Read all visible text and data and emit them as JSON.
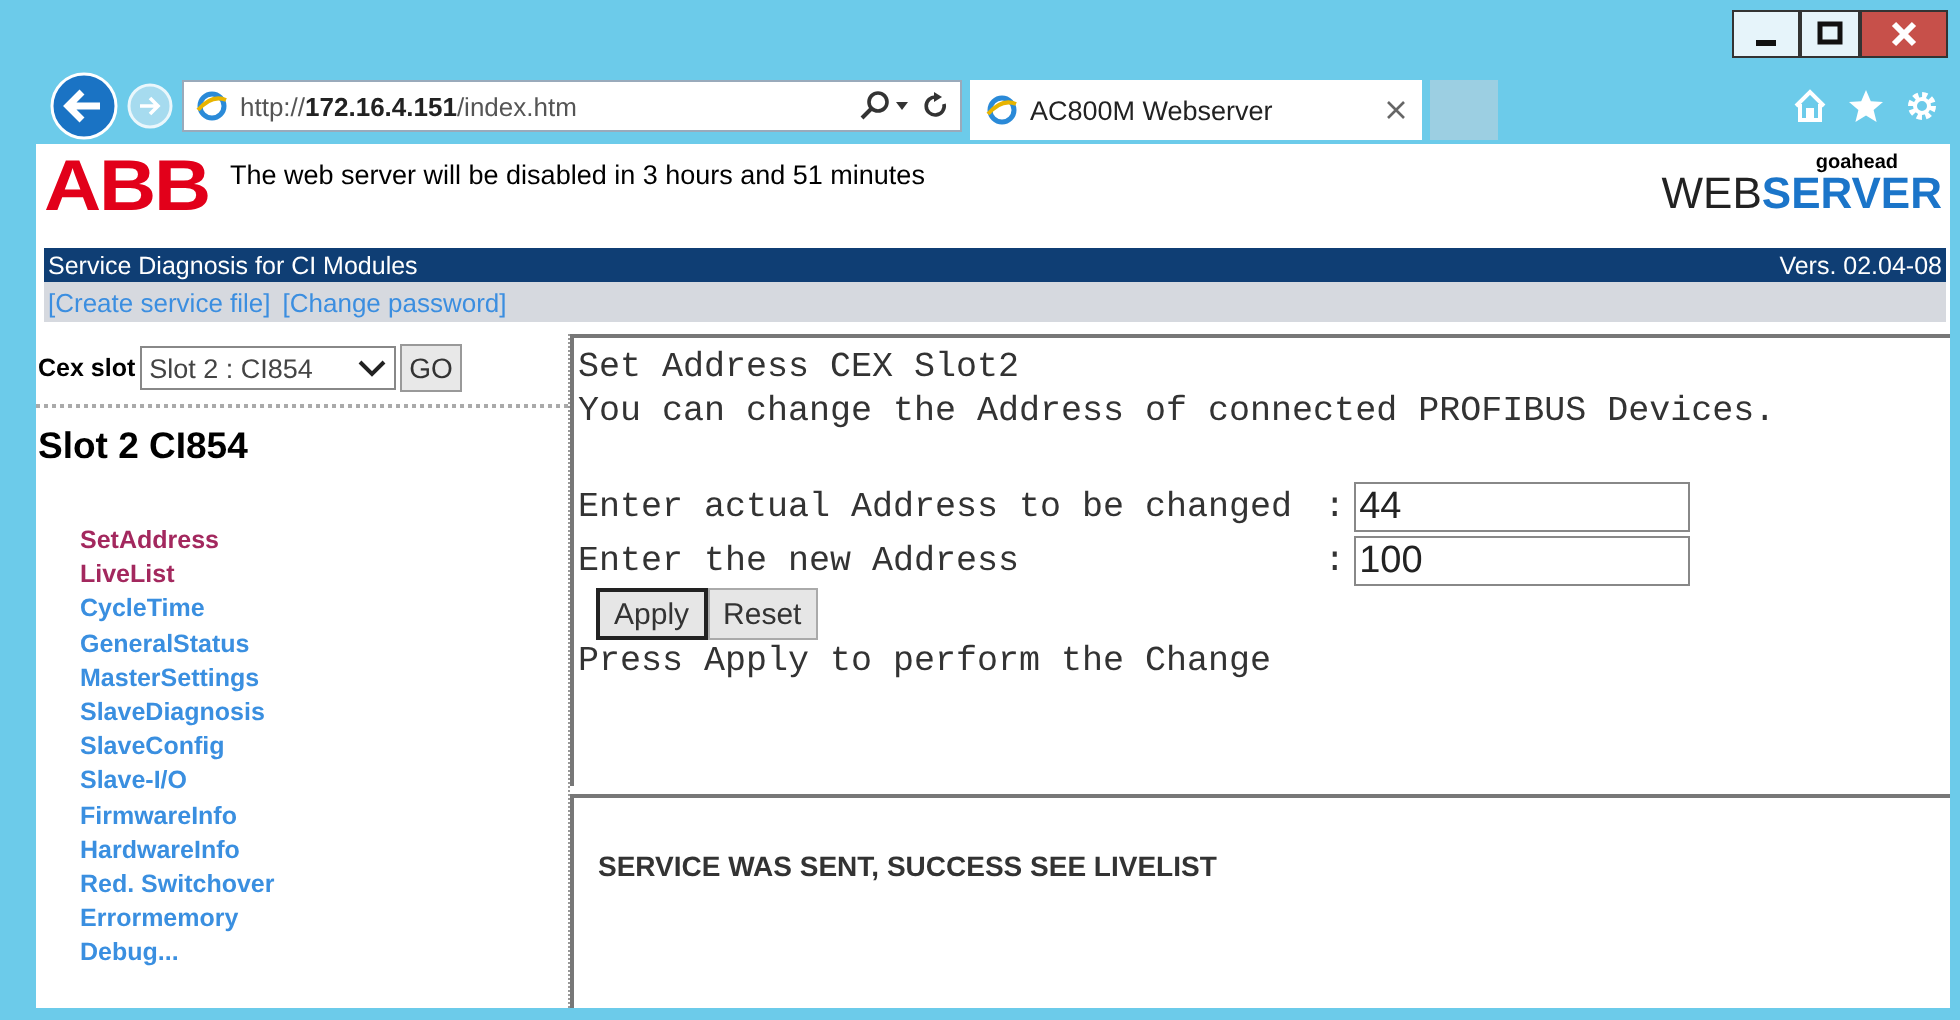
{
  "browser": {
    "address": "http://**172.16.4.151**/index.htm",
    "tab_title": "AC800M Webserver"
  },
  "header": {
    "logo": "ABB",
    "notice": "The web server will be disabled in 3 hours and 51 minutes",
    "brand_small": "goahead",
    "brand_part_1": "WEB",
    "brand_part_2": "SERVER"
  },
  "title_bar": {
    "title": "Service Diagnosis for CI Modules",
    "version": "Vers. 02.04-08"
  },
  "links": [
    "[Create service file]",
    "[Change password]"
  ],
  "nav": {
    "slot_label": "Cex slot",
    "slot_value": "Slot 2 : CI854",
    "go": "GO",
    "heading": "Slot 2 CI854",
    "items": [
      {
        "label": "SetAddress",
        "visited": true
      },
      {
        "label": "LiveList",
        "visited": true
      },
      {
        "label": "CycleTime",
        "visited": false
      },
      {
        "label": "GeneralStatus",
        "visited": false
      },
      {
        "label": "MasterSettings",
        "visited": false
      },
      {
        "label": "SlaveDiagnosis",
        "visited": false
      },
      {
        "label": "SlaveConfig",
        "visited": false
      },
      {
        "label": "Slave-I/O",
        "visited": false
      },
      {
        "label": "FirmwareInfo",
        "visited": false
      },
      {
        "label": "HardwareInfo",
        "visited": false
      },
      {
        "label": "Red. Switchover",
        "visited": false
      },
      {
        "label": "Errormemory",
        "visited": false
      },
      {
        "label": "Debug...",
        "visited": false
      }
    ]
  },
  "main": {
    "title": "Set Address CEX Slot2",
    "description": "You can change the Address of connected PROFIBUS Devices.",
    "fields": [
      {
        "label": "Enter actual Address to be changed",
        "separator": ":",
        "value": "44"
      },
      {
        "label": "Enter the new Address",
        "separator": ":",
        "value": "100"
      }
    ],
    "buttons": [
      {
        "label": "Apply",
        "default": true
      },
      {
        "label": "Reset",
        "default": false
      }
    ],
    "hint": "Press Apply to perform the Change"
  },
  "status": {
    "message": "SERVICE WAS SENT, SUCCESS SEE LIVELIST"
  }
}
